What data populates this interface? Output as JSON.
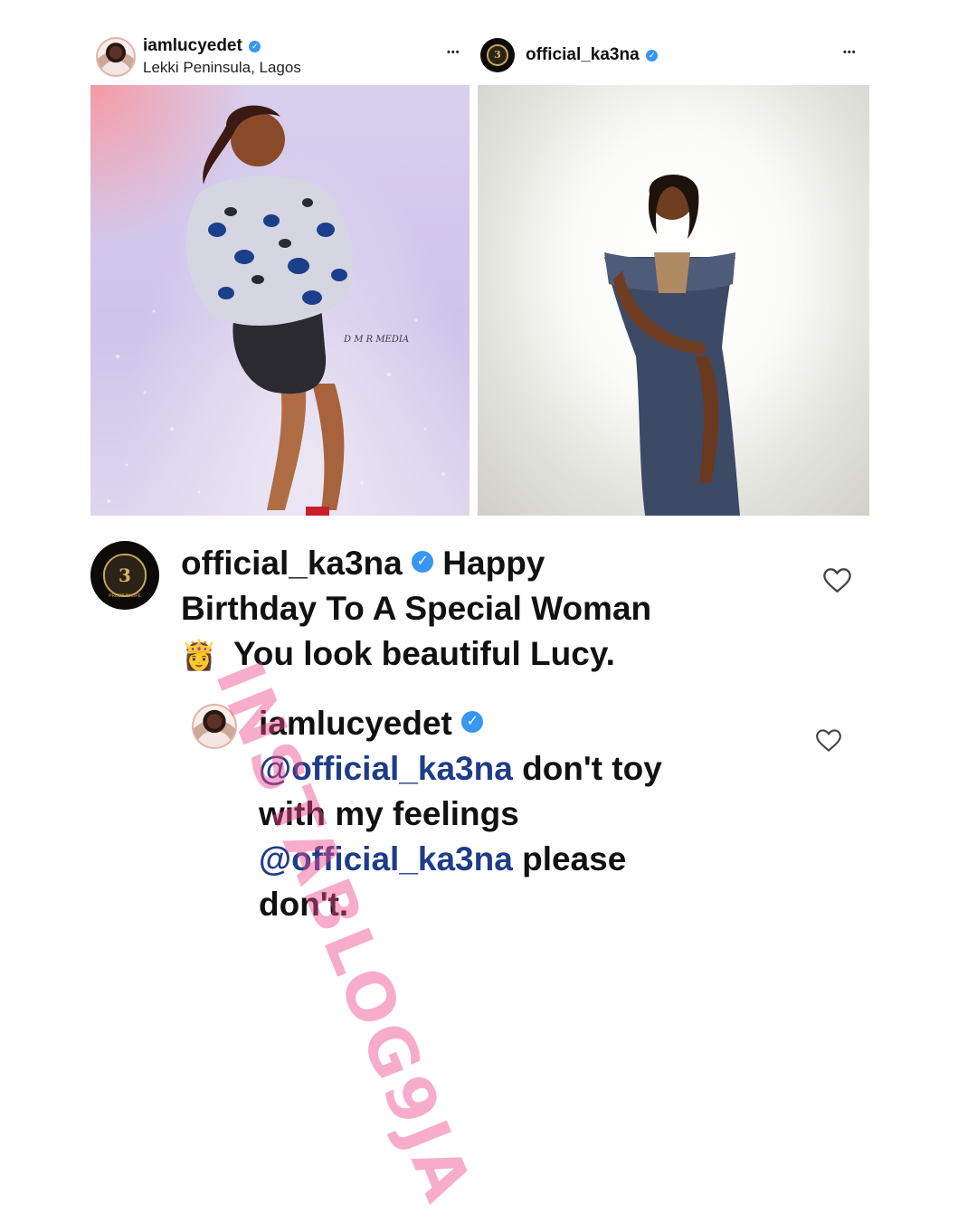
{
  "post_left": {
    "username": "iamlucyedet",
    "location": "Lekki Peninsula, Lagos",
    "more_label": "•••",
    "photo_credit": "D M R MEDIA"
  },
  "post_right": {
    "username": "official_ka3na",
    "more_label": "•••"
  },
  "verified_glyph": "✓",
  "comment": {
    "username": "official_ka3na",
    "line1": "Happy",
    "line2": "Birthday To A Special Woman",
    "emoji": "👸",
    "line3": "You look beautiful Lucy."
  },
  "reply": {
    "username": "iamlucyedet",
    "mention1": "@official_ka3na",
    "text1": "don't toy",
    "line2": "with my feelings",
    "mention2": "@official_ka3na",
    "text2": "please",
    "line4": "don't."
  },
  "ka3na_logo_text": "3",
  "ka3na_logo_subtext": "PREMIUM LIFE",
  "watermark": "INSTABLOG9JA",
  "colors": {
    "verified": "#3897f0",
    "mention": "#1f3c88",
    "watermark": "#f0468c"
  }
}
